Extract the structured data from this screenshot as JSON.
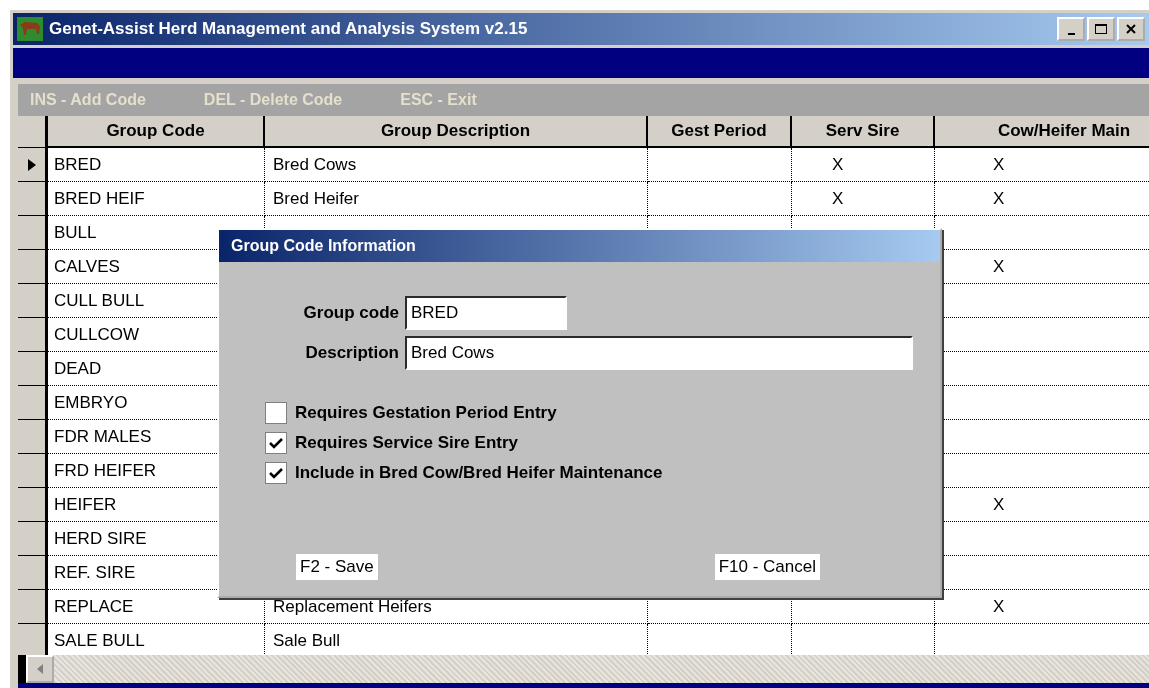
{
  "window": {
    "title": "Genet-Assist Herd Management and Analysis System v2.15"
  },
  "toolbar": [
    "INS - Add Code",
    "DEL - Delete Code",
    "ESC - Exit"
  ],
  "table": {
    "columns": [
      "Group Code",
      "Group Description",
      "Gest Period",
      "Serv Sire",
      "Cow/Heifer Main"
    ],
    "rows": [
      {
        "code": "BRED",
        "description": "Bred Cows",
        "serv_sire": "X",
        "cow_heifer_main": "X",
        "selected": true
      },
      {
        "code": "BRED HEIF",
        "description": "Bred Heifer",
        "serv_sire": "X",
        "cow_heifer_main": "X",
        "selected": false
      },
      {
        "code": "BULL",
        "selected": false
      },
      {
        "code": "CALVES",
        "cow_heifer_main": "X",
        "selected": false
      },
      {
        "code": "CULL BULL",
        "selected": false
      },
      {
        "code": "CULLCOW",
        "selected": false
      },
      {
        "code": "DEAD",
        "selected": false
      },
      {
        "code": "EMBRYO",
        "selected": false
      },
      {
        "code": "FDR MALES",
        "selected": false
      },
      {
        "code": "FRD HEIFER",
        "selected": false
      },
      {
        "code": "HEIFER",
        "cow_heifer_main": "X",
        "selected": false
      },
      {
        "code": "HERD SIRE",
        "selected": false
      },
      {
        "code": "REF. SIRE",
        "selected": false
      },
      {
        "code": "REPLACE",
        "description": "Replacement Heifers",
        "cow_heifer_main": "X",
        "selected": false
      },
      {
        "code": "SALE BULL",
        "description": "Sale Bull",
        "selected": false
      }
    ]
  },
  "dialog": {
    "title": "Group Code Information",
    "fields": [
      {
        "label": "Group code",
        "value": "BRED",
        "kind": "short"
      },
      {
        "label": "Description",
        "value": "Bred Cows",
        "kind": "long"
      }
    ],
    "checkboxes": [
      {
        "label": "Requires Gestation Period Entry",
        "checked": false
      },
      {
        "label": "Requires Service Sire Entry",
        "checked": true
      },
      {
        "label": "Include in Bred Cow/Bred Heifer Maintenance",
        "checked": true
      }
    ],
    "buttons": [
      "F2 - Save",
      "F10 - Cancel"
    ]
  }
}
